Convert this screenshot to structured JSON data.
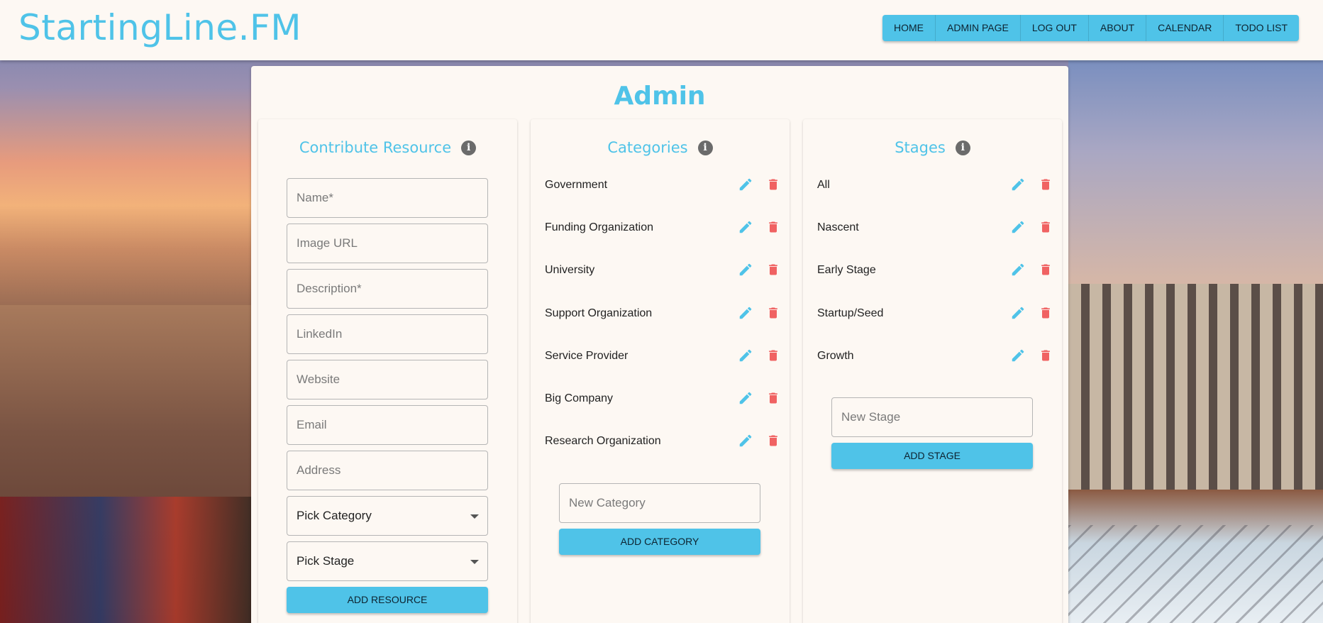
{
  "brand": "StartingLine.FM",
  "nav": [
    "HOME",
    "ADMIN PAGE",
    "LOG OUT",
    "ABOUT",
    "CALENDAR",
    "TODO LIST"
  ],
  "page_title": "Admin",
  "contribute": {
    "title": "Contribute Resource",
    "info_icon": "info-icon",
    "fields": {
      "name": "Name*",
      "image_url": "Image URL",
      "description": "Description*",
      "linkedin": "LinkedIn",
      "website": "Website",
      "email": "Email",
      "address": "Address"
    },
    "category_select": "Pick Category",
    "stage_select": "Pick Stage",
    "button": "ADD RESOURCE"
  },
  "categories": {
    "title": "Categories",
    "items": [
      "Government",
      "Funding Organization",
      "University",
      "Support Organization",
      "Service Provider",
      "Big Company",
      "Research Organization"
    ],
    "input_placeholder": "New Category",
    "button": "ADD CATEGORY"
  },
  "stages": {
    "title": "Stages",
    "items": [
      "All",
      "Nascent",
      "Early Stage",
      "Startup/Seed",
      "Growth"
    ],
    "input_placeholder": "New Stage",
    "button": "ADD STAGE"
  },
  "colors": {
    "accent": "#4fc3e8",
    "edit": "#4fc3e8",
    "delete": "#f06262",
    "surface": "#fdf8f3"
  }
}
